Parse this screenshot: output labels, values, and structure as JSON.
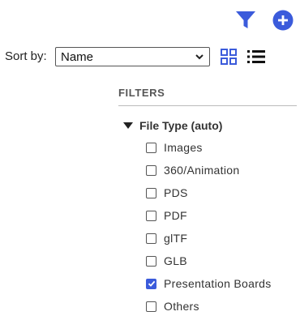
{
  "toolbar": {
    "filter_icon": "filter-icon",
    "add_icon": "add-circle-icon",
    "accent_color": "#3b5bdb"
  },
  "sort": {
    "label": "Sort by:",
    "selected": "Name"
  },
  "view": {
    "grid_icon": "grid-view-icon",
    "list_icon": "list-view-icon"
  },
  "filters": {
    "title": "FILTERS",
    "group": {
      "label": "File Type (auto)",
      "expanded": true,
      "options": [
        {
          "label": "Images",
          "checked": false
        },
        {
          "label": "360/Animation",
          "checked": false
        },
        {
          "label": "PDS",
          "checked": false
        },
        {
          "label": "PDF",
          "checked": false
        },
        {
          "label": "glTF",
          "checked": false
        },
        {
          "label": "GLB",
          "checked": false
        },
        {
          "label": "Presentation Boards",
          "checked": true
        },
        {
          "label": "Others",
          "checked": false
        }
      ]
    }
  }
}
